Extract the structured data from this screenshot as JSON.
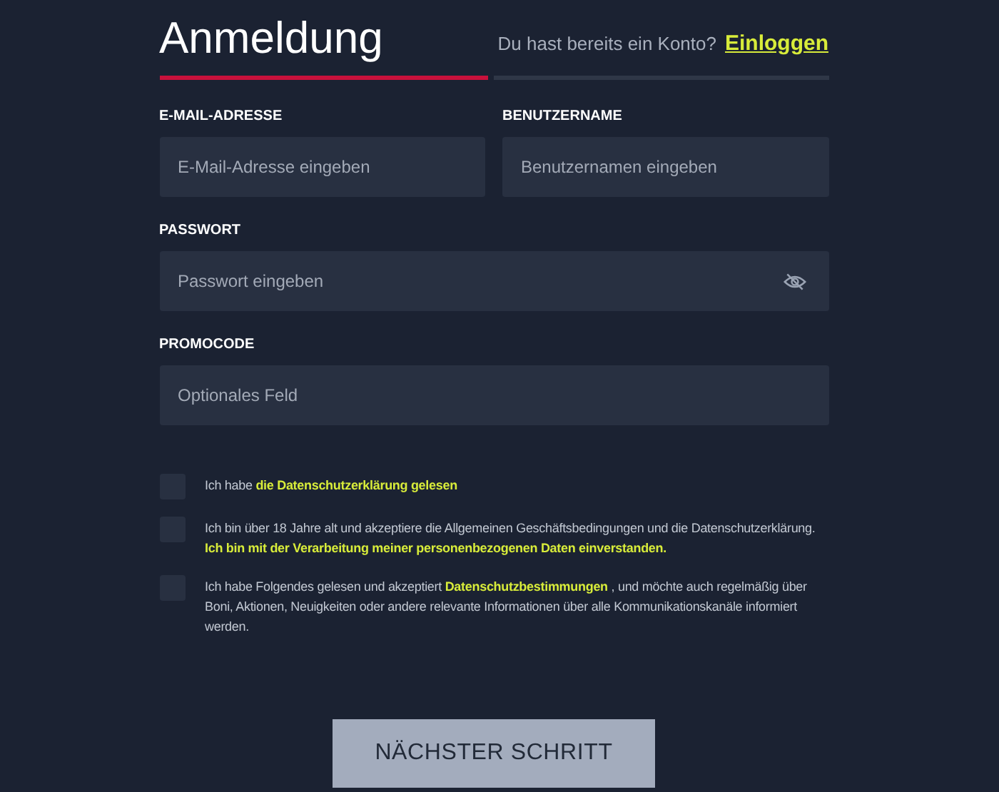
{
  "title": "Anmeldung",
  "login_prompt": {
    "text": "Du hast bereits ein Konto?",
    "link": "Einloggen"
  },
  "progress": {
    "level": 0.5
  },
  "fields": [
    {
      "label": "E-MAIL-ADRESSE",
      "placeholder": "E-Mail-Adresse eingeben",
      "kind": "text"
    },
    {
      "label": "BENUTZERNAME",
      "placeholder": "Benutzernamen eingeben",
      "kind": "text"
    },
    {
      "label": "PASSWORT",
      "placeholder": "Passwort eingeben",
      "kind": "password"
    },
    {
      "label": "PROMOCODE",
      "placeholder": "Optionales Feld",
      "kind": "text"
    }
  ],
  "consents": [
    {
      "text": "Ich habe **die Datenschutzerklärung gelesen**",
      "checked": false
    },
    {
      "text": "Ich bin über 18 Jahre alt und akzeptiere die Allgemeinen Geschäftsbedingungen und die Datenschutzerklärung. **Ich bin mit der Verarbeitung meiner personenbezogenen Daten einverstanden.**",
      "checked": false
    },
    {
      "text": "Ich habe Folgendes gelesen und akzeptiert **Datenschutzbestimmungen** , und möchte auch regelmäßig über Boni, Aktionen, Neuigkeiten oder andere relevante Informationen über alle Kommunikationskanäle informiert werden.",
      "checked": false
    }
  ],
  "next_button": "NÄCHSTER SCHRITT"
}
